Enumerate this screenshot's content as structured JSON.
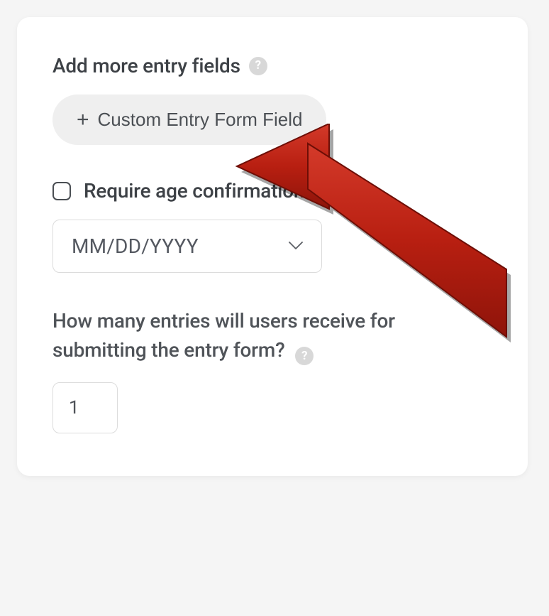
{
  "headings": {
    "add_fields": "Add more entry fields"
  },
  "buttons": {
    "custom_field": "Custom Entry Form Field"
  },
  "checkboxes": {
    "age_confirm": "Require age confirmation"
  },
  "date_format": {
    "selected": "MM/DD/YYYY"
  },
  "questions": {
    "entries_count": "How many entries will users receive for submitting the entry form?"
  },
  "inputs": {
    "entries_value": "1"
  }
}
